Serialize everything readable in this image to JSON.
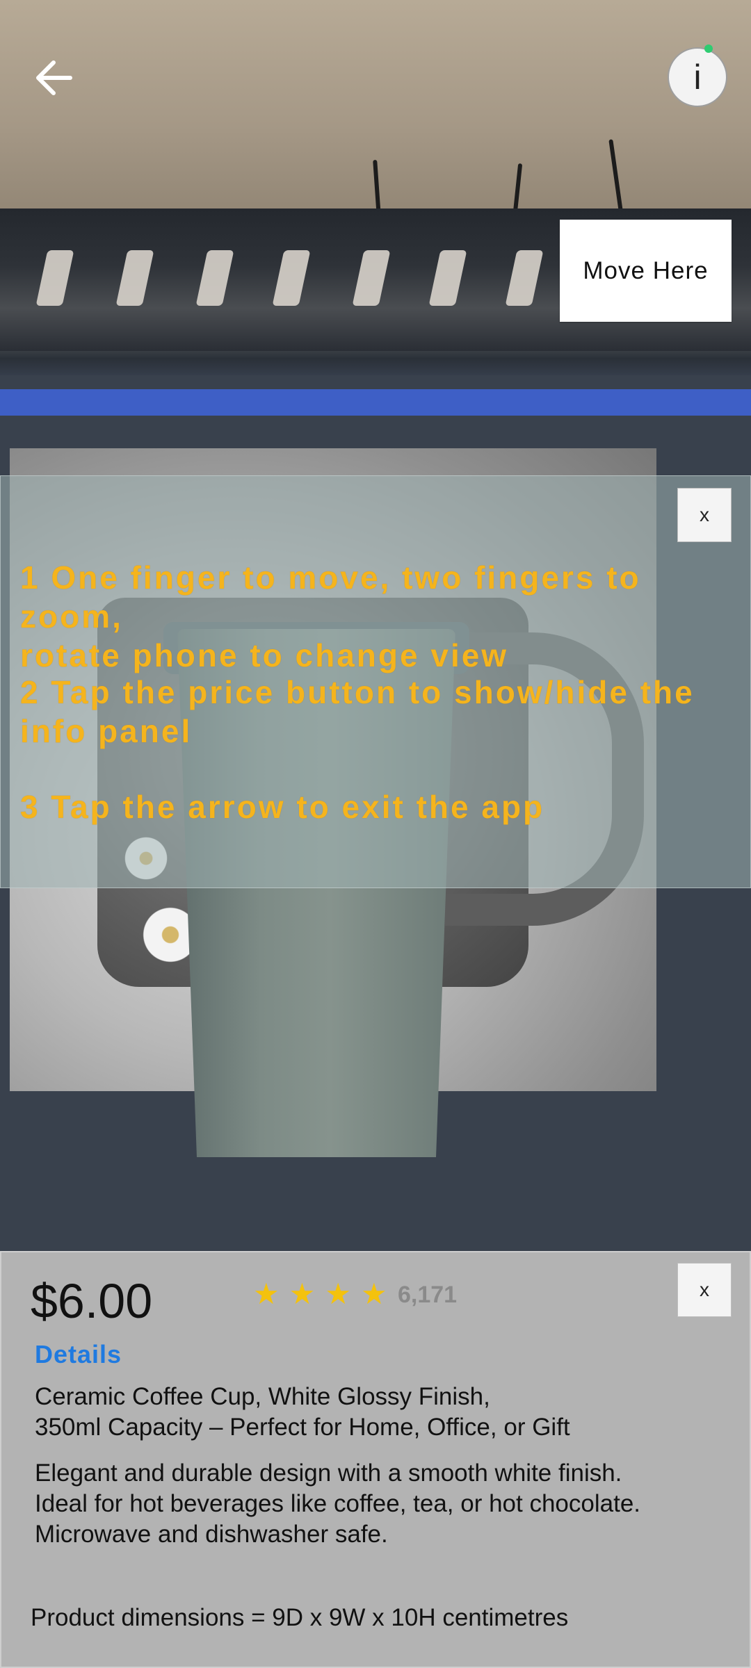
{
  "top_bar": {
    "info_button_label": "i",
    "move_here_label": "Move Here"
  },
  "instructions": {
    "close_label": "x",
    "steps": [
      {
        "line1": "1 One finger to move, two fingers to zoom,",
        "line2": "rotate phone to change view"
      },
      {
        "line1": "2 Tap the price button to show/hide the",
        "line2": "info panel"
      },
      {
        "line1": "3 Tap the arrow to exit the app",
        "line2": ""
      }
    ]
  },
  "product": {
    "close_label": "x",
    "price": "$6.00",
    "rating_stars": 4,
    "rating_count": "6,171",
    "details_label": "Details",
    "title_line1": "Ceramic Coffee Cup, White Glossy Finish,",
    "title_line2": "350ml Capacity – Perfect for Home, Office, or Gift",
    "description_line1": "Elegant and durable design with a smooth white finish.",
    "description_line2": "Ideal for hot beverages like coffee, tea, or hot chocolate.",
    "description_line3": "Microwave and dishwasher safe.",
    "dimensions": "Product dimensions = 9D x 9W x 10H centimetres"
  },
  "colors": {
    "instruction_text": "#f5b41d",
    "star": "#f4c20d",
    "details_link": "#1f7ae0",
    "panel_background": "#b3b3b3"
  },
  "icons": [
    "back-arrow-icon",
    "info-icon",
    "star-icon"
  ]
}
